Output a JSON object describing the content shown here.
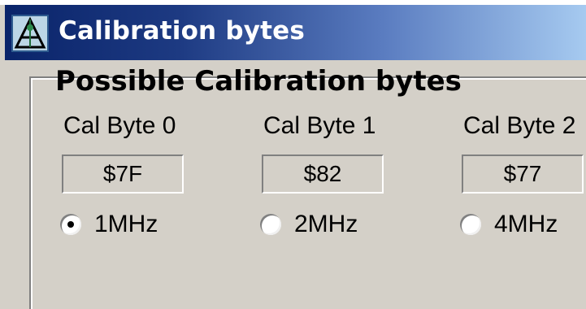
{
  "window": {
    "title": "Calibration bytes",
    "icon": "app-triangle-icon"
  },
  "group": {
    "title": "Possible Calibration bytes"
  },
  "columns": [
    {
      "label": "Cal Byte 0",
      "value": "$7F",
      "option": "1MHz",
      "selected": true
    },
    {
      "label": "Cal Byte 1",
      "value": "$82",
      "option": "2MHz",
      "selected": false
    },
    {
      "label": "Cal Byte 2",
      "value": "$77",
      "option": "4MHz",
      "selected": false
    }
  ],
  "colors": {
    "titlebar_start": "#0a246a",
    "titlebar_end": "#a6caf0",
    "face": "#d4d0c8"
  }
}
